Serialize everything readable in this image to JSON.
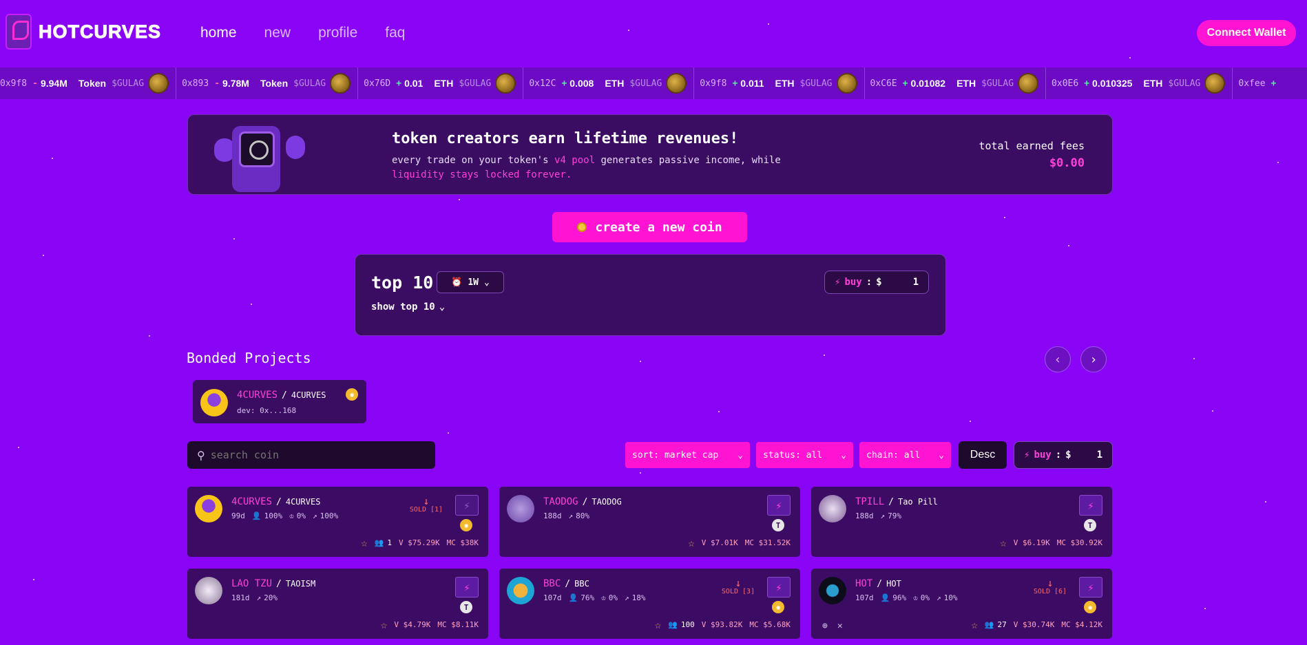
{
  "header": {
    "logo": "HOTCURVES",
    "nav": [
      "home",
      "new",
      "profile",
      "faq"
    ],
    "connect": "Connect Wallet"
  },
  "ticker": [
    {
      "addr": "0x9f8",
      "sign": "-",
      "amount": "9.94M",
      "unit": "Token",
      "tag": "$GULAG"
    },
    {
      "addr": "0x893",
      "sign": "-",
      "amount": "9.78M",
      "unit": "Token",
      "tag": "$GULAG"
    },
    {
      "addr": "0x76D",
      "sign": "+",
      "amount": "0.01",
      "unit": "ETH",
      "tag": "$GULAG"
    },
    {
      "addr": "0x12C",
      "sign": "+",
      "amount": "0.008",
      "unit": "ETH",
      "tag": "$GULAG"
    },
    {
      "addr": "0x9f8",
      "sign": "+",
      "amount": "0.011",
      "unit": "ETH",
      "tag": "$GULAG"
    },
    {
      "addr": "0xC6E",
      "sign": "+",
      "amount": "0.01082",
      "unit": "ETH",
      "tag": "$GULAG"
    },
    {
      "addr": "0x0E6",
      "sign": "+",
      "amount": "0.010325",
      "unit": "ETH",
      "tag": "$GULAG"
    },
    {
      "addr": "0xfee",
      "sign": "+",
      "amount": "",
      "unit": "",
      "tag": ""
    }
  ],
  "banner": {
    "title": "token creators earn lifetime revenues!",
    "line1_pre": "every trade on your token's ",
    "line1_hl": "v4 pool",
    "line1_post": " generates passive income, while",
    "line2": "liquidity stays locked forever.",
    "fees_label": "total earned fees",
    "fees_value": "$0.00"
  },
  "create_label": "create a new coin",
  "top10": {
    "title": "top 10",
    "period": "1W",
    "show": "show top 10",
    "buy_label": "buy",
    "buy_currency": "$",
    "buy_amount": "1"
  },
  "bonded": {
    "title": "Bonded Projects",
    "card": {
      "ticker": "4CURVES",
      "name": "4CURVES",
      "dev": "dev: 0x...168"
    }
  },
  "filters": {
    "search_placeholder": "search coin",
    "sort": "sort: market cap",
    "status": "status: all",
    "chain": "chain: all",
    "order": "Desc",
    "buy_label": "buy",
    "buy_currency": "$",
    "buy_amount": "1"
  },
  "cards": [
    {
      "ticker": "4CURVES",
      "name": "4CURVES",
      "age": "99d",
      "holders_pct": "100%",
      "dev_pct": "0%",
      "progress": "100%",
      "sold": "SOLD [1]",
      "chain": "bnb",
      "holders": "1",
      "vol": "V $75.29K",
      "mc": "MC $38K"
    },
    {
      "ticker": "TAODOG",
      "name": "TAODOG",
      "age": "188d",
      "progress": "80%",
      "chain": "t",
      "vol": "V $7.01K",
      "mc": "MC $31.52K"
    },
    {
      "ticker": "TPILL",
      "name": "Tao Pill",
      "age": "188d",
      "progress": "79%",
      "chain": "t",
      "vol": "V $6.19K",
      "mc": "MC $30.92K"
    },
    {
      "ticker": "LAO TZU",
      "name": "TAOISM",
      "age": "181d",
      "progress": "20%",
      "chain": "t",
      "vol": "V $4.79K",
      "mc": "MC $8.11K"
    },
    {
      "ticker": "BBC",
      "name": "BBC",
      "age": "107d",
      "holders_pct": "76%",
      "dev_pct": "0%",
      "progress": "18%",
      "sold": "SOLD [3]",
      "chain": "bnb",
      "holders": "100",
      "vol": "V $93.82K",
      "mc": "MC $5.68K"
    },
    {
      "ticker": "HOT",
      "name": "HOT",
      "age": "107d",
      "holders_pct": "96%",
      "dev_pct": "0%",
      "progress": "10%",
      "sold": "SOLD [6]",
      "chain": "bnb",
      "holders": "27",
      "vol": "V $30.74K",
      "mc": "MC $4.12K"
    }
  ],
  "colors": {
    "background": "#8a05f5",
    "accent": "#ff14d4",
    "panel": "#3a0d62"
  }
}
